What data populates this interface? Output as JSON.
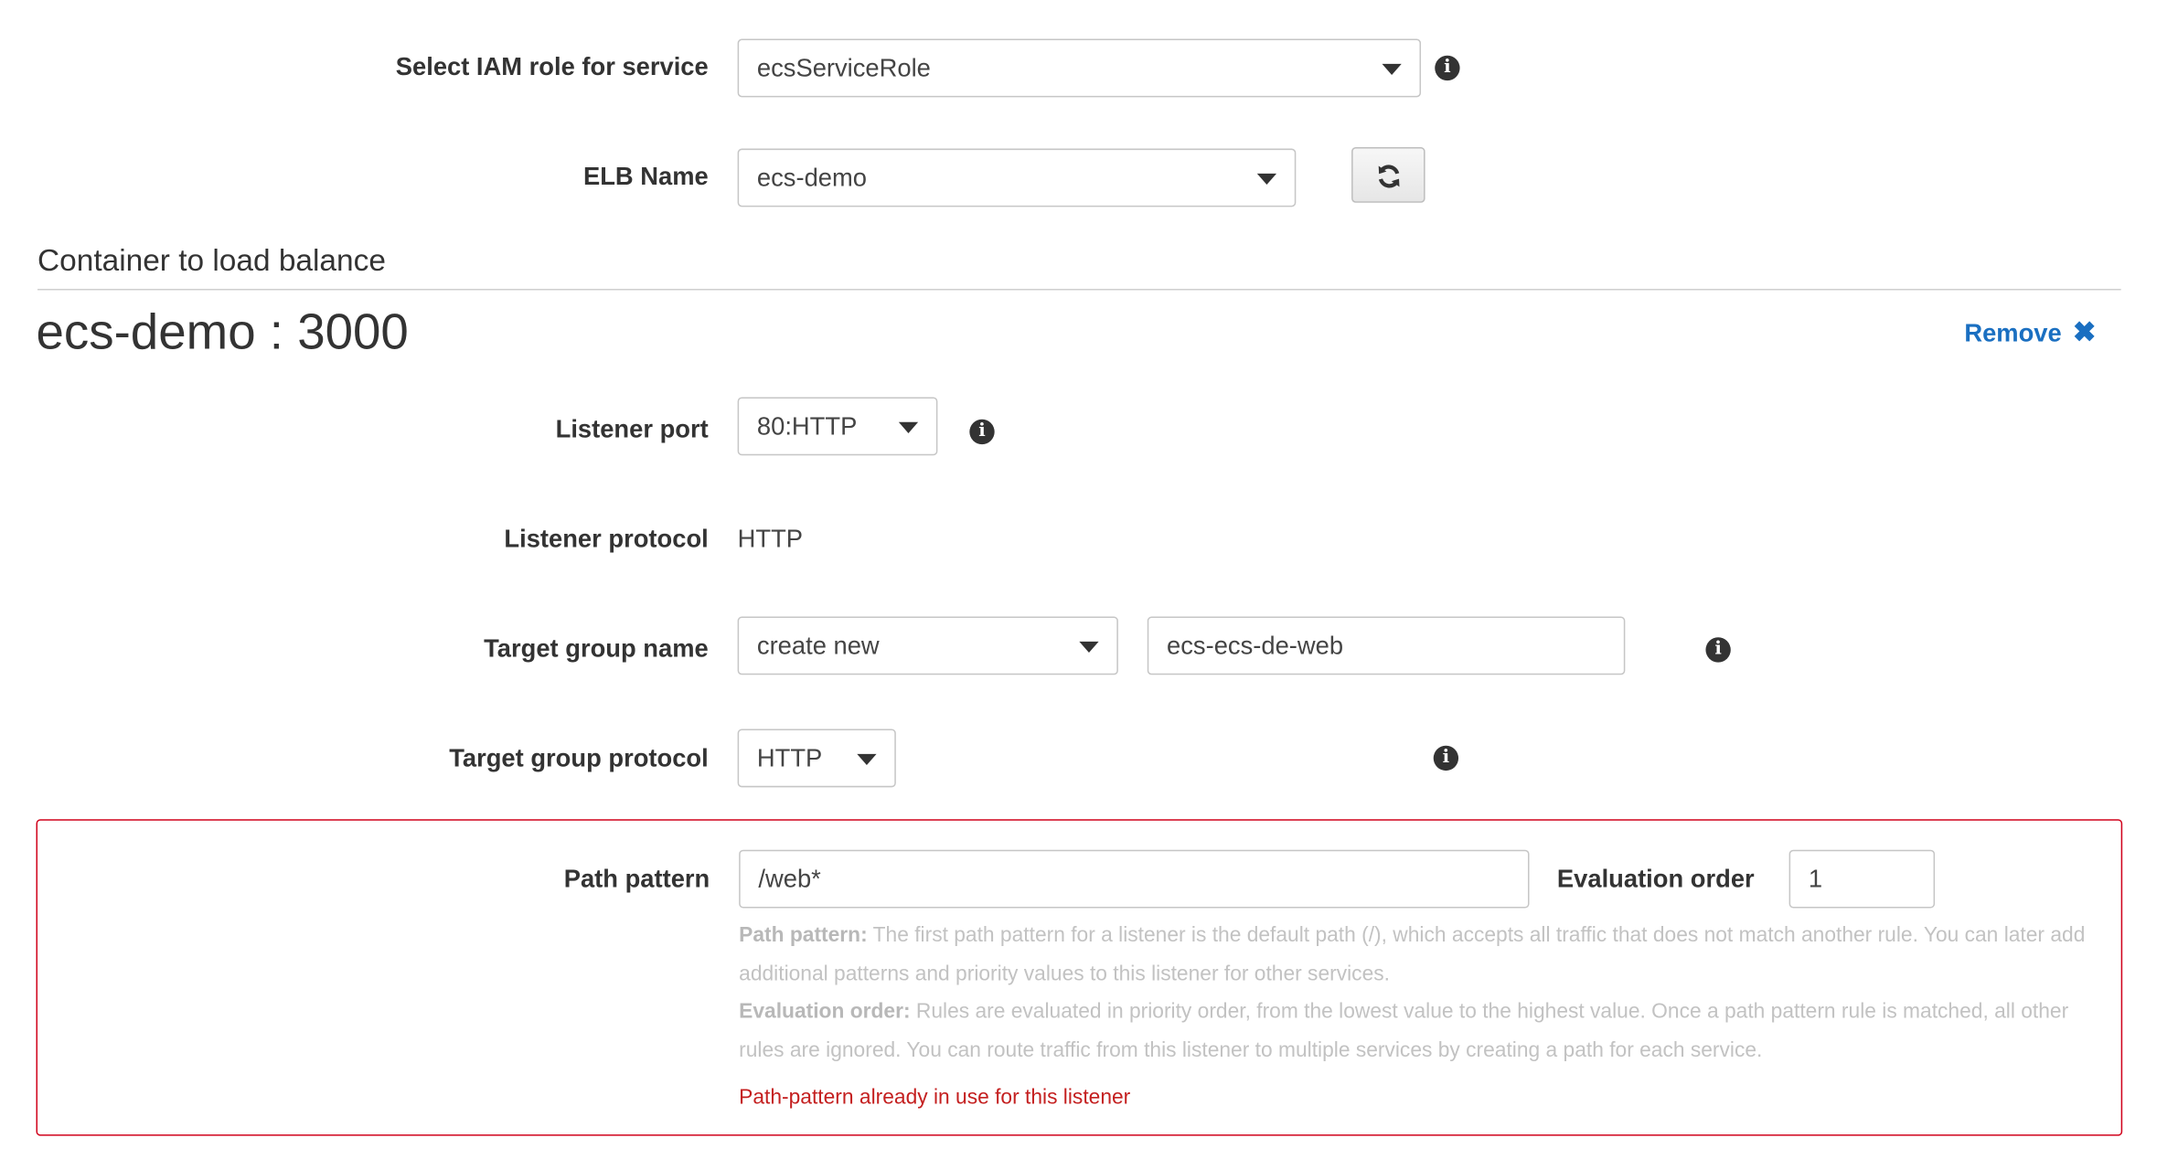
{
  "iam_role": {
    "label": "Select IAM role for service",
    "value": "ecsServiceRole"
  },
  "elb": {
    "label": "ELB Name",
    "value": "ecs-demo"
  },
  "container_section": {
    "title": "Container to load balance"
  },
  "container": {
    "title": "ecs-demo : 3000",
    "remove_label": "Remove",
    "remove_icon": "✖"
  },
  "listener_port": {
    "label": "Listener port",
    "value": "80:HTTP"
  },
  "listener_protocol": {
    "label": "Listener protocol",
    "value": "HTTP"
  },
  "target_group_name": {
    "label": "Target group name",
    "select_value": "create new",
    "input_value": "ecs-ecs-de-web"
  },
  "target_group_protocol": {
    "label": "Target group protocol",
    "value": "HTTP"
  },
  "path_pattern": {
    "label": "Path pattern",
    "value": "/web*",
    "evaluation_order_label": "Evaluation order",
    "evaluation_order_value": "1",
    "help_path_title": "Path pattern:",
    "help_path_text": " The first path pattern for a listener is the default path (/), which accepts all traffic that does not match another rule. You can later add additional patterns and priority values to this listener for other services.",
    "help_order_title": "Evaluation order:",
    "help_order_text": " Rules are evaluated in priority order, from the lowest value to the highest value. Once a path pattern rule is matched, all other rules are ignored. You can route traffic from this listener to multiple services by creating a path for each service.",
    "error_message": "Path-pattern already in use for this listener"
  },
  "colors": {
    "error": "#d0021b",
    "link": "#1a6fc1",
    "help_text": "#c2c2c2"
  },
  "icons": {
    "info": "info-icon",
    "dropdown": "caret-down-icon",
    "refresh": "refresh-icon",
    "remove": "close-icon"
  }
}
